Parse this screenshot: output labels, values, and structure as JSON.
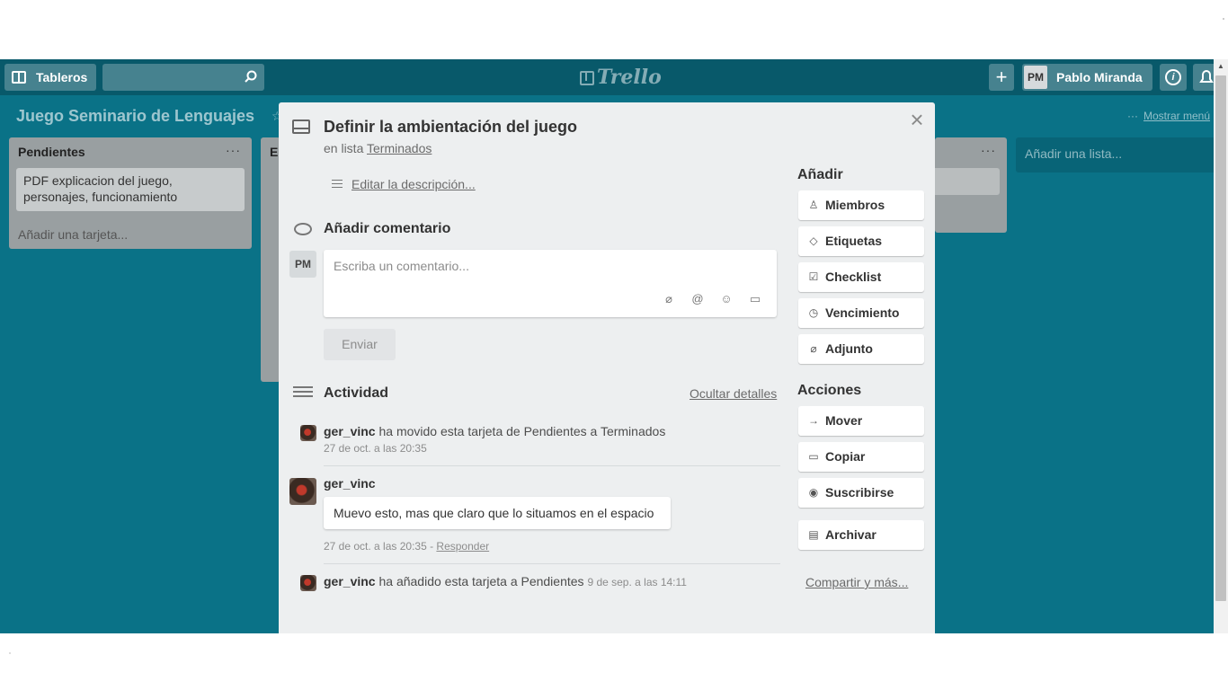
{
  "header": {
    "boards_label": "Tableros",
    "logo_text": "Trello",
    "plus_label": "+",
    "user_initials": "PM",
    "user_name": "Pablo Miranda",
    "info_label": "i"
  },
  "board": {
    "title": "Juego Seminario de Lenguajes",
    "show_menu": "Mostrar menú",
    "add_list": "Añadir una lista..."
  },
  "lists": [
    {
      "title": "Pendientes",
      "card": "PDF explicacion del juego, personajes, funcionamiento",
      "add_card": "Añadir una tarjeta..."
    },
    {
      "title_fragment": "E"
    }
  ],
  "modal": {
    "title": "Definir la ambientación del juego",
    "in_list_prefix": "en lista",
    "list_name": "Terminados",
    "edit_description": "Editar la descripción...",
    "comment_heading": "Añadir comentario",
    "commenter_initials": "PM",
    "comment_placeholder": "Escriba un comentario...",
    "send_label": "Enviar",
    "activity_heading": "Actividad",
    "hide_details": "Ocultar detalles",
    "activities": [
      {
        "user": "ger_vinc",
        "text": "ha movido esta tarjeta de Pendientes a Terminados",
        "date": "27 de oct. a las 20:35"
      },
      {
        "user": "ger_vinc",
        "comment": "Muevo esto, mas que claro que lo situamos en el espacio",
        "date": "27 de oct. a las 20:35 - ",
        "reply": "Responder"
      },
      {
        "user": "ger_vinc",
        "text": "ha añadido esta tarjeta a Pendientes",
        "date": "9 de sep. a las 14:11"
      }
    ]
  },
  "sidebar": {
    "add_heading": "Añadir",
    "add_buttons": [
      "Miembros",
      "Etiquetas",
      "Checklist",
      "Vencimiento",
      "Adjunto"
    ],
    "actions_heading": "Acciones",
    "action_buttons": [
      "Mover",
      "Copiar",
      "Suscribirse",
      "Archivar"
    ],
    "share_link": "Compartir y más..."
  },
  "colors": {
    "board_bg": "#0a7287",
    "header_bg": "#08596a",
    "modal_bg": "#edeff0"
  }
}
